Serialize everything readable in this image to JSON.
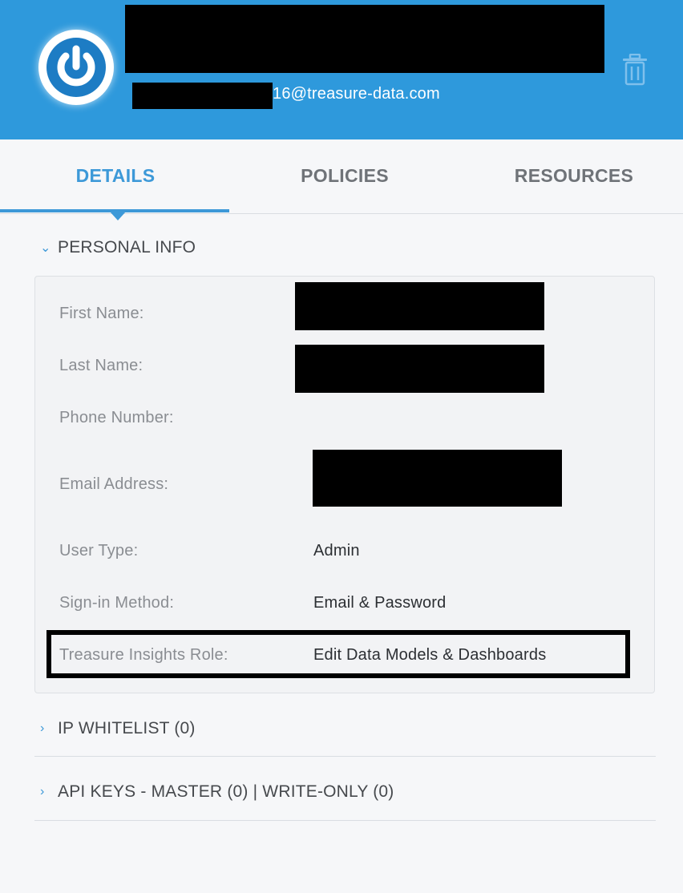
{
  "header": {
    "email_suffix": "16@treasure-data.com",
    "avatar_icon": "power-icon",
    "delete_icon": "trash-icon",
    "colors": {
      "header_bg": "#2e99dc",
      "accent": "#3d99d8"
    }
  },
  "tabs": [
    {
      "label": "DETAILS",
      "active": true
    },
    {
      "label": "POLICIES",
      "active": false
    },
    {
      "label": "RESOURCES",
      "active": false
    }
  ],
  "personal_info": {
    "title": "PERSONAL INFO",
    "fields": {
      "first_name": {
        "label": "First Name:"
      },
      "last_name": {
        "label": "Last Name:"
      },
      "phone": {
        "label": "Phone Number:"
      },
      "email": {
        "label": "Email Address:"
      },
      "user_type": {
        "label": "User Type:",
        "value": "Admin"
      },
      "sign_in": {
        "label": "Sign-in Method:",
        "value": "Email & Password"
      },
      "insights_role": {
        "label": "Treasure Insights Role:",
        "value": "Edit Data Models & Dashboards"
      }
    }
  },
  "sections": {
    "ip_whitelist": "IP WHITELIST (0)",
    "api_keys": "API KEYS - MASTER (0) | WRITE-ONLY (0)"
  }
}
